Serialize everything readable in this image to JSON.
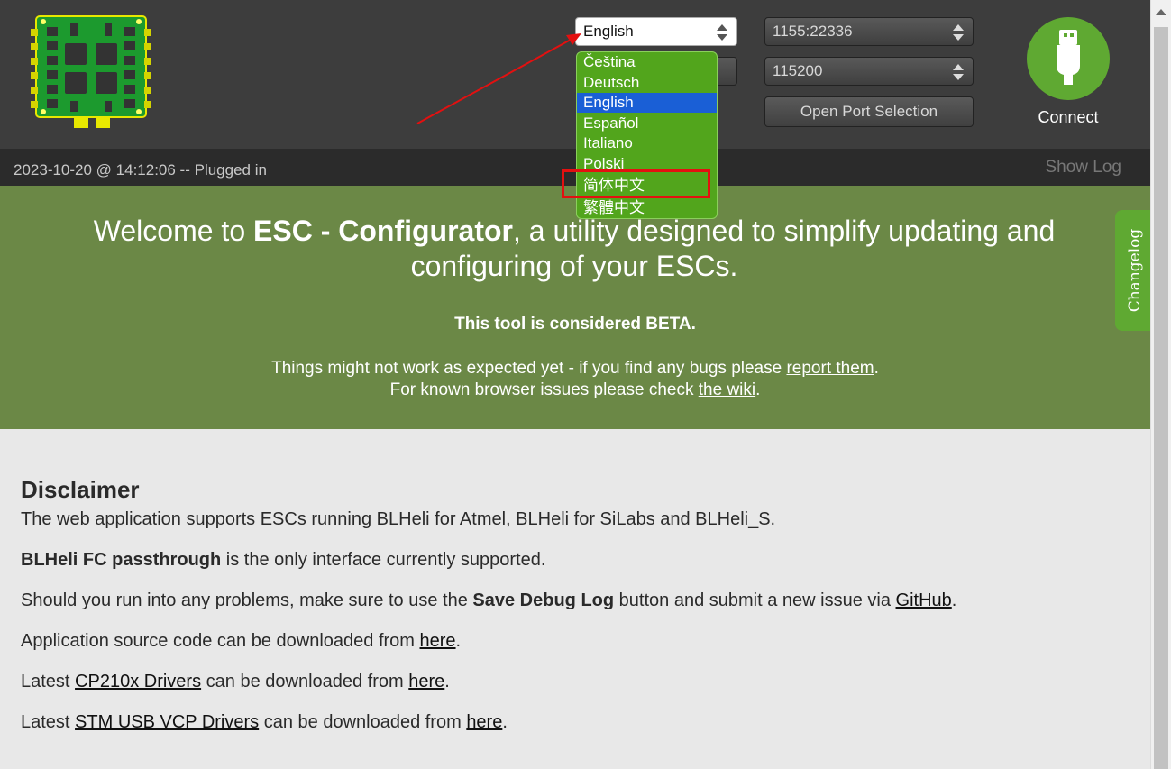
{
  "header": {
    "language": {
      "selected": "English"
    },
    "port": {
      "selected": "1155:22336"
    },
    "baud": {
      "selected": "115200"
    },
    "open_port_label": "Open Port Selection",
    "connect_label": "Connect"
  },
  "language_dropdown": {
    "options": [
      "Čeština",
      "Deutsch",
      "English",
      "Español",
      "Italiano",
      "Polski",
      "简体中文",
      "繁體中文"
    ],
    "selected_index": 2
  },
  "status_bar": {
    "text": "2023-10-20 @ 14:12:06 -- Plugged in",
    "show_log": "Show Log"
  },
  "welcome": {
    "heading_pre": "Welcome to ",
    "heading_bold": "ESC - Configurator",
    "heading_post": ", a utility designed to simplify updating and configuring of your ESCs.",
    "beta_note": "This tool is considered BETA.",
    "bugs_pre": "Things might not work as expected yet - if you find any bugs please ",
    "bugs_link": "report them",
    "bugs_post": ".",
    "wiki_pre": "For known browser issues please check ",
    "wiki_link": "the wiki",
    "wiki_post": "."
  },
  "changelog_label": "Changelog",
  "disclaimer": {
    "title": "Disclaimer",
    "p1": "The web application supports ESCs running BLHeli for Atmel, BLHeli for SiLabs and BLHeli_S.",
    "p2_bold": "BLHeli FC passthrough",
    "p2_post": " is the only interface currently supported.",
    "p3_pre": "Should you run into any problems, make sure to use the ",
    "p3_bold": "Save Debug Log",
    "p3_mid": " button and submit a new issue via ",
    "p3_link": "GitHub",
    "p3_post": ".",
    "p4_pre": "Application source code can be downloaded from ",
    "p4_link": "here",
    "p4_post": ".",
    "p5_pre": "Latest ",
    "p5_link1": "CP210x Drivers",
    "p5_mid": " can be downloaded from ",
    "p5_link2": "here",
    "p5_post": ".",
    "p6_pre": "Latest ",
    "p6_link1": "STM USB VCP Drivers",
    "p6_mid": " can be downloaded from ",
    "p6_link2": "here",
    "p6_post": "."
  },
  "colors": {
    "header_bg": "#3d3d3d",
    "welcome_bg": "#6b8846",
    "accent_green": "#5fa932",
    "dropdown_bg": "#52a51c",
    "selected_option": "#1a5fd6",
    "annotation_red": "#e31010"
  },
  "icons": {
    "logo": "esc-board-logo",
    "connect": "usb-plug-icon"
  }
}
